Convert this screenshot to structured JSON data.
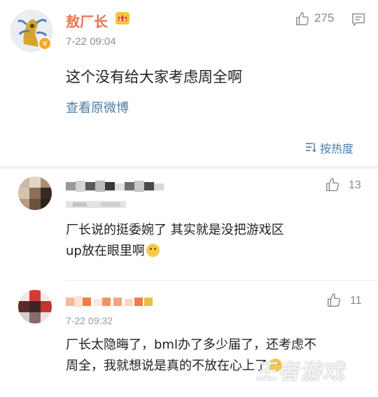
{
  "post": {
    "username": "敖厂长",
    "time": "7-22 09:04",
    "like_count": "275",
    "text": "这个没有给大家考虑周全啊",
    "view_original": "查看原微博",
    "sort_label": "按热度"
  },
  "comments": [
    {
      "time": "",
      "like_count": "13",
      "lines": [
        "厂长说的挺委婉了 其实就是没把游戏区",
        "up放在眼里啊"
      ]
    },
    {
      "time": "7-22 09:32",
      "like_count": "11",
      "lines": [
        "厂长太隐晦了，bml办了多少届了，还考虑不",
        "周全，我就想说是真的不放在心上了"
      ]
    }
  ],
  "watermark": "王者游戏",
  "colors": {
    "username": "#eb7350",
    "link": "#4d7ea8",
    "badge": "#f5a623",
    "muted": "#8f8f8f"
  },
  "icons": [
    "crown-icon",
    "verified-badge-icon",
    "thumbs-up-icon",
    "comment-icon",
    "sort-icon",
    "smile-emoji-icon"
  ]
}
